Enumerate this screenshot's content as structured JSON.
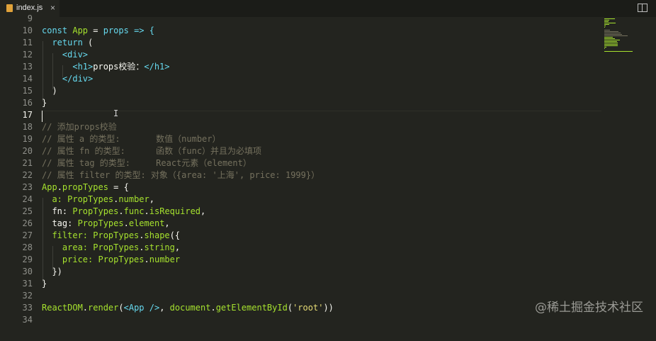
{
  "tab": {
    "filename": "index.js",
    "close": "×"
  },
  "watermark": "@稀土掘金技术社区",
  "colors": {
    "background": "#23241f",
    "keyword": "#66d9ef",
    "function": "#a6e22e",
    "string": "#e6db74",
    "comment": "#75715e",
    "text": "#f8f8f2"
  },
  "active_line": "17",
  "lines": [
    {
      "n": "9",
      "segs": []
    },
    {
      "n": "10",
      "segs": [
        {
          "t": "const ",
          "c": "kw"
        },
        {
          "t": "App",
          "c": "fn"
        },
        {
          "t": " = ",
          "c": "plain"
        },
        {
          "t": "props",
          "c": "kw"
        },
        {
          "t": " => {",
          "c": "kw"
        }
      ]
    },
    {
      "n": "11",
      "segs": [
        {
          "t": "  return ",
          "c": "kw"
        },
        {
          "t": "(",
          "c": "plain"
        }
      ]
    },
    {
      "n": "12",
      "segs": [
        {
          "t": "    <div>",
          "c": "tag"
        }
      ]
    },
    {
      "n": "13",
      "segs": [
        {
          "t": "      <h1>",
          "c": "tag"
        },
        {
          "t": "props校验：",
          "c": "plain"
        },
        {
          "t": "</h1>",
          "c": "tag"
        }
      ]
    },
    {
      "n": "14",
      "segs": [
        {
          "t": "    </div>",
          "c": "tag"
        }
      ]
    },
    {
      "n": "15",
      "segs": [
        {
          "t": "  )",
          "c": "plain"
        }
      ]
    },
    {
      "n": "16",
      "segs": [
        {
          "t": "}",
          "c": "plain"
        }
      ]
    },
    {
      "n": "17",
      "segs": []
    },
    {
      "n": "18",
      "segs": [
        {
          "t": "// 添加props校验",
          "c": "cm"
        }
      ]
    },
    {
      "n": "19",
      "segs": [
        {
          "t": "// 属性 a 的类型:       数值（number）",
          "c": "cm"
        }
      ]
    },
    {
      "n": "20",
      "segs": [
        {
          "t": "// 属性 fn 的类型:      函数（func）并且为必填项",
          "c": "cm"
        }
      ]
    },
    {
      "n": "21",
      "segs": [
        {
          "t": "// 属性 tag 的类型:     React元素（element）",
          "c": "cm"
        }
      ]
    },
    {
      "n": "22",
      "segs": [
        {
          "t": "// 属性 filter 的类型: 对象（{area: '上海', price: 1999}）",
          "c": "cm"
        }
      ]
    },
    {
      "n": "23",
      "segs": [
        {
          "t": "App",
          "c": "fn"
        },
        {
          "t": ".",
          "c": "plain"
        },
        {
          "t": "propTypes",
          "c": "fn"
        },
        {
          "t": " = {",
          "c": "plain"
        }
      ]
    },
    {
      "n": "24",
      "segs": [
        {
          "t": "  a: ",
          "c": "fn"
        },
        {
          "t": "PropTypes",
          "c": "fn"
        },
        {
          "t": ".",
          "c": "plain"
        },
        {
          "t": "number",
          "c": "fn"
        },
        {
          "t": ",",
          "c": "plain"
        }
      ]
    },
    {
      "n": "25",
      "segs": [
        {
          "t": "  fn: ",
          "c": "plain"
        },
        {
          "t": "PropTypes",
          "c": "fn"
        },
        {
          "t": ".",
          "c": "plain"
        },
        {
          "t": "func",
          "c": "fn"
        },
        {
          "t": ".",
          "c": "plain"
        },
        {
          "t": "isRequired",
          "c": "fn"
        },
        {
          "t": ",",
          "c": "plain"
        }
      ]
    },
    {
      "n": "26",
      "segs": [
        {
          "t": "  tag: ",
          "c": "plain"
        },
        {
          "t": "PropTypes",
          "c": "fn"
        },
        {
          "t": ".",
          "c": "plain"
        },
        {
          "t": "element",
          "c": "fn"
        },
        {
          "t": ",",
          "c": "plain"
        }
      ]
    },
    {
      "n": "27",
      "segs": [
        {
          "t": "  filter: ",
          "c": "fn"
        },
        {
          "t": "PropTypes",
          "c": "fn"
        },
        {
          "t": ".",
          "c": "plain"
        },
        {
          "t": "shape",
          "c": "fn"
        },
        {
          "t": "({",
          "c": "plain"
        }
      ]
    },
    {
      "n": "28",
      "segs": [
        {
          "t": "    area: ",
          "c": "fn"
        },
        {
          "t": "PropTypes",
          "c": "fn"
        },
        {
          "t": ".",
          "c": "plain"
        },
        {
          "t": "string",
          "c": "fn"
        },
        {
          "t": ",",
          "c": "plain"
        }
      ]
    },
    {
      "n": "29",
      "segs": [
        {
          "t": "    price: ",
          "c": "fn"
        },
        {
          "t": "PropTypes",
          "c": "fn"
        },
        {
          "t": ".",
          "c": "plain"
        },
        {
          "t": "number",
          "c": "fn"
        }
      ]
    },
    {
      "n": "30",
      "segs": [
        {
          "t": "  })",
          "c": "plain"
        }
      ]
    },
    {
      "n": "31",
      "segs": [
        {
          "t": "}",
          "c": "plain"
        }
      ]
    },
    {
      "n": "32",
      "segs": []
    },
    {
      "n": "33",
      "segs": [
        {
          "t": "ReactDOM",
          "c": "fn"
        },
        {
          "t": ".",
          "c": "plain"
        },
        {
          "t": "render",
          "c": "fn"
        },
        {
          "t": "(",
          "c": "plain"
        },
        {
          "t": "<App />",
          "c": "tag"
        },
        {
          "t": ", ",
          "c": "plain"
        },
        {
          "t": "document",
          "c": "fn"
        },
        {
          "t": ".",
          "c": "plain"
        },
        {
          "t": "getElementById",
          "c": "fn"
        },
        {
          "t": "(",
          "c": "plain"
        },
        {
          "t": "'root'",
          "c": "str"
        },
        {
          "t": "))",
          "c": "plain"
        }
      ]
    },
    {
      "n": "34",
      "segs": []
    }
  ]
}
